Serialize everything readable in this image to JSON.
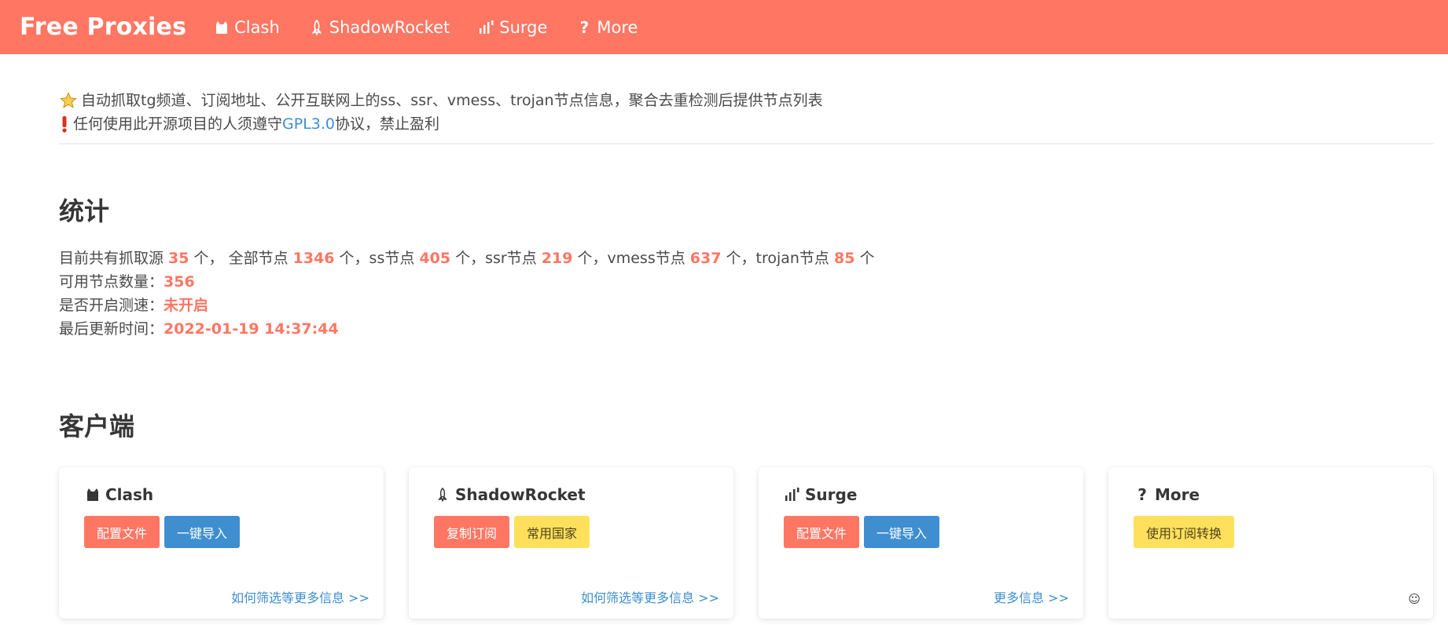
{
  "navbar": {
    "brand": "Free Proxies",
    "items": [
      {
        "label": "Clash",
        "icon": "cat-icon"
      },
      {
        "label": "ShadowRocket",
        "icon": "rocket-icon"
      },
      {
        "label": "Surge",
        "icon": "signal-bars-icon"
      },
      {
        "label": "More",
        "icon": "question-icon"
      }
    ],
    "background": "#ff7663"
  },
  "notice": {
    "line1": "自动抓取tg频道、订阅地址、公开互联网上的ss、ssr、vmess、trojan节点信息，聚合去重检测后提供节点列表",
    "line2_prefix": "任何使用此开源项目的人须遵守",
    "line2_link": "GPL3.0",
    "line2_suffix": "协议，禁止盈利"
  },
  "stats": {
    "title": "统计",
    "line1": {
      "p1": "目前共有抓取源 ",
      "sources": "35",
      "p2": " 个， 全部节点 ",
      "all": "1346",
      "p3": " 个，ss节点 ",
      "ss": "405",
      "p4": " 个，ssr节点 ",
      "ssr": "219",
      "p5": " 个，vmess节点 ",
      "vmess": "637",
      "p6": " 个，trojan节点 ",
      "trojan": "85",
      "p7": " 个"
    },
    "available_label": "可用节点数量：",
    "available": "356",
    "speedtest_label": "是否开启测速：",
    "speedtest": "未开启",
    "updated_label": "最后更新时间：",
    "updated": "2022-01-19 14:37:44"
  },
  "clients": {
    "title": "客户端",
    "cards": [
      {
        "title": "Clash",
        "icon": "cat-icon",
        "buttons": [
          "配置文件",
          "一键导入"
        ],
        "link": "如何筛选等更多信息 >>"
      },
      {
        "title": "ShadowRocket",
        "icon": "rocket-icon",
        "buttons": [
          "复制订阅",
          "常用国家"
        ],
        "link": "如何筛选等更多信息 >>"
      },
      {
        "title": "Surge",
        "icon": "signal-bars-icon",
        "buttons": [
          "配置文件",
          "一键导入"
        ],
        "link": "更多信息 >>"
      },
      {
        "title": "More",
        "icon": "question-icon",
        "buttons": [
          "使用订阅转换"
        ],
        "footer": "☺"
      }
    ]
  },
  "colors": {
    "accent": "#ff7663",
    "link": "#3e8ed0",
    "warning": "#ffe05d"
  }
}
